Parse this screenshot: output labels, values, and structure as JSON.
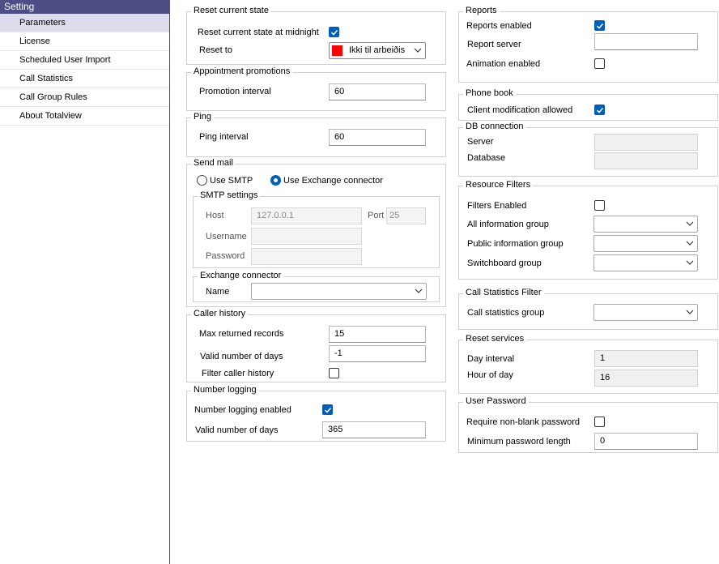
{
  "sidebar": {
    "title": "Setting",
    "items": [
      {
        "label": "Parameters"
      },
      {
        "label": "License"
      },
      {
        "label": "Scheduled User Import"
      },
      {
        "label": "Call Statistics"
      },
      {
        "label": "Call Group Rules"
      },
      {
        "label": "About Totalview"
      }
    ]
  },
  "reset_state": {
    "title": "Reset current state",
    "midnight_label": "Reset current state at midnight",
    "midnight_checked": true,
    "reset_to_label": "Reset to",
    "reset_to_value": "Ikki til arbeiðis",
    "reset_to_color": "#ff0000"
  },
  "appointment": {
    "title": "Appointment promotions",
    "interval_label": "Promotion interval",
    "interval_value": "60"
  },
  "ping": {
    "title": "Ping",
    "interval_label": "Ping interval",
    "interval_value": "60"
  },
  "send_mail": {
    "title": "Send mail",
    "smtp_option": "Use SMTP",
    "exchange_option": "Use Exchange connector",
    "selected": "exchange",
    "smtp_settings": {
      "title": "SMTP settings",
      "host_label": "Host",
      "host_value": "127.0.0.1",
      "port_label": "Port",
      "port_value": "25",
      "username_label": "Username",
      "password_label": "Password"
    },
    "exchange": {
      "title": "Exchange connector",
      "name_label": "Name",
      "name_value": ""
    }
  },
  "caller_history": {
    "title": "Caller history",
    "max_label": "Max returned records",
    "max_value": "15",
    "days_label": "Valid number of days",
    "days_value": "-1",
    "filter_label": "Filter caller history",
    "filter_checked": false
  },
  "number_logging": {
    "title": "Number logging",
    "enabled_label": "Number logging enabled",
    "enabled_checked": true,
    "days_label": "Valid number of days",
    "days_value": "365"
  },
  "reports": {
    "title": "Reports",
    "enabled_label": "Reports enabled",
    "enabled_checked": true,
    "server_label": "Report server",
    "server_value": "",
    "animation_label": "Animation enabled",
    "animation_checked": false
  },
  "phone_book": {
    "title": "Phone book",
    "client_mod_label": "Client modification allowed",
    "client_mod_checked": true
  },
  "db": {
    "title": "DB connection",
    "server_label": "Server",
    "database_label": "Database"
  },
  "resource_filters": {
    "title": "Resource Filters",
    "enabled_label": "Filters Enabled",
    "enabled_checked": false,
    "all_info_label": "All information group",
    "public_info_label": "Public information group",
    "switchboard_label": "Switchboard group"
  },
  "call_stats_filter": {
    "title": "Call Statistics Filter",
    "group_label": "Call statistics group"
  },
  "reset_services": {
    "title": "Reset services",
    "day_label": "Day interval",
    "day_value": "1",
    "hour_label": "Hour of day",
    "hour_value": "16"
  },
  "user_password": {
    "title": "User Password",
    "require_label": "Require non-blank password",
    "require_checked": false,
    "min_label": "Minimum password length",
    "min_value": "0"
  },
  "colors": {
    "accent": "#005fb8",
    "sidebar_header": "#4e4e86",
    "sidebar_active": "#dcdcec"
  }
}
